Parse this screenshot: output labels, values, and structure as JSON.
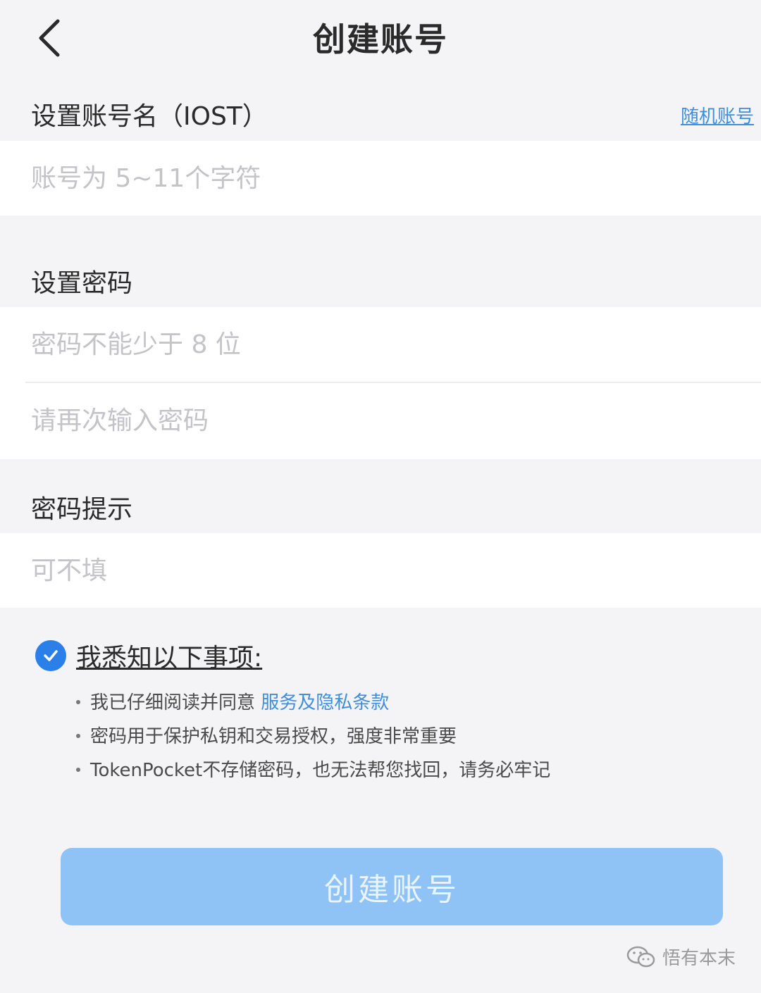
{
  "header": {
    "title": "创建账号",
    "back_icon": "chevron-left-icon"
  },
  "account": {
    "label": "设置账号名（IOST）",
    "random_link": "随机账号",
    "placeholder": "账号为 5~11个字符"
  },
  "password": {
    "label": "设置密码",
    "placeholder": "密码不能少于 8 位",
    "confirm_placeholder": "请再次输入密码"
  },
  "hint": {
    "label": "密码提示",
    "placeholder": "可不填"
  },
  "ack": {
    "checked": true,
    "title": "我悉知以下事项:",
    "items": [
      {
        "text": "我已仔细阅读并同意 ",
        "link": "服务及隐私条款"
      },
      {
        "text": "密码用于保护私钥和交易授权，强度非常重要"
      },
      {
        "text": "TokenPocket不存储密码，也无法帮您找回，请务必牢记"
      }
    ]
  },
  "create_button": {
    "label": "创建账号"
  },
  "watermark": {
    "text": "悟有本末"
  },
  "colors": {
    "background": "#f4f4f6",
    "accent": "#2a7fe8",
    "link": "#3e8ede",
    "button_disabled": "#90c3f5",
    "placeholder": "#c3c3c8"
  }
}
